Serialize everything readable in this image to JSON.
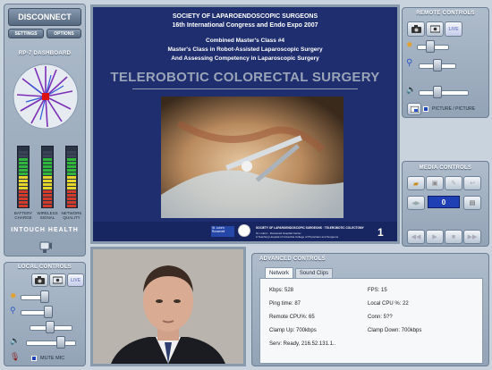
{
  "left": {
    "disconnect_label": "DISCONNECT",
    "settings_label": "SETTINGS",
    "options_label": "OPTIONS",
    "dashboard_title": "RP-7 DASHBOARD",
    "indicators": [
      "BATTERY CHARGE",
      "WIRELESS SIGNAL",
      "NETWORK QUALITY"
    ],
    "brand": "INTOUCH HEALTH"
  },
  "slide": {
    "lines": [
      "SOCIETY OF LAPAROENDOSCOPIC SURGEONS",
      "16th International Congress and Endo Expo 2007",
      "Combined Master's Class #4",
      "Master's Class in Robot-Assisted Laparoscopic Surgery",
      "And Assessing Competency in Laparoscopic Surgery"
    ],
    "title": "TELEROBOTIC COLORECTAL SURGERY",
    "footer_text": "SOCIETY OF LAPAROENDOSCOPIC SURGEONS · TELEROBOTIC COLECTOMY",
    "hospital_text": "St. Luke's - Roosevelt Hospital Center\nA Teaching Hospital of Columbia College of Physicians and Surgeons",
    "badge_text": "St. Luke's Roosevelt",
    "slide_number": "1"
  },
  "remote": {
    "title": "REMOTE CONTROLS",
    "live_label": "LIVE",
    "picture_label": "PICTURE / PICTURE"
  },
  "media": {
    "title": "MEDIA CONTROLS",
    "counter": "0"
  },
  "local": {
    "title": "LOCAL CONTROLS",
    "live_label": "LIVE",
    "mute_label": "MUTE MIC"
  },
  "advanced": {
    "title": "ADVANCED CONTROLS",
    "tabs": [
      "Network",
      "Sound Clips"
    ],
    "active_tab": 0,
    "stats": {
      "kbps": "Kbps: 528",
      "fps": "FPS: 15",
      "ping": "Ping time: 87",
      "local_cpu": "Local CPU %: 22",
      "remote_cpu": "Remote CPU%: 65",
      "conn": "Conn: 5??",
      "clamp_up": "Clamp Up: 700kbps",
      "clamp_down": "Clamp Down: 700kbps",
      "serv": "Serv: Ready, 216.52.131.1.."
    }
  },
  "colors": {
    "slide_bg": "#1e2e6e",
    "title_gray": "#9aa4b8",
    "panel": "#a3b2c2",
    "dark_button": "#55687f",
    "meter_green": "#2fb63b",
    "meter_yellow": "#e5d42a",
    "meter_red": "#d23a2a"
  },
  "levels": {
    "battery": 0.9,
    "wireless": 0.9,
    "network": 0.9
  }
}
